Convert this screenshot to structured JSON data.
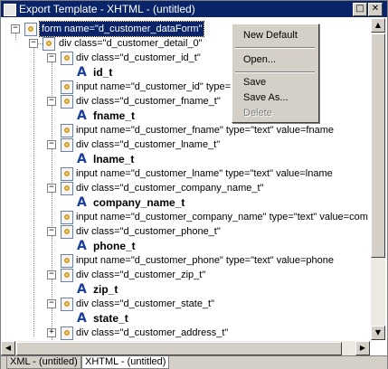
{
  "window": {
    "title": "Export Template - XHTML - (untitled)",
    "minimize_glyph": "□",
    "close_glyph": "✕"
  },
  "tree": {
    "items": [
      {
        "text": "form name=\"d_customer_dataForm\"",
        "kind": "element",
        "selected": true
      },
      {
        "text": "div class=\"d_customer_detail_0\"",
        "kind": "element"
      },
      {
        "text": "div class=\"d_customer_id_t\"",
        "kind": "element"
      },
      {
        "text": "id_t",
        "kind": "text"
      },
      {
        "text": "input name=\"d_customer_id\" type=",
        "kind": "element"
      },
      {
        "text": "div class=\"d_customer_fname_t\"",
        "kind": "element"
      },
      {
        "text": "fname_t",
        "kind": "text"
      },
      {
        "text": "input name=\"d_customer_fname\" type=\"text\" value=fname",
        "kind": "element"
      },
      {
        "text": "div class=\"d_customer_lname_t\"",
        "kind": "element"
      },
      {
        "text": "lname_t",
        "kind": "text"
      },
      {
        "text": "input name=\"d_customer_lname\" type=\"text\" value=lname",
        "kind": "element"
      },
      {
        "text": "div class=\"d_customer_company_name_t\"",
        "kind": "element"
      },
      {
        "text": "company_name_t",
        "kind": "text"
      },
      {
        "text": "input name=\"d_customer_company_name\" type=\"text\" value=com",
        "kind": "element"
      },
      {
        "text": "div class=\"d_customer_phone_t\"",
        "kind": "element"
      },
      {
        "text": "phone_t",
        "kind": "text"
      },
      {
        "text": "input name=\"d_customer_phone\" type=\"text\" value=phone",
        "kind": "element"
      },
      {
        "text": "div class=\"d_customer_zip_t\"",
        "kind": "element"
      },
      {
        "text": "zip_t",
        "kind": "text"
      },
      {
        "text": "div class=\"d_customer_state_t\"",
        "kind": "element"
      },
      {
        "text": "state_t",
        "kind": "text"
      },
      {
        "text": "div class=\"d_customer_address_t\"",
        "kind": "element"
      }
    ]
  },
  "context_menu": {
    "new_default": "New Default",
    "open": "Open...",
    "save": "Save",
    "save_as": "Save As...",
    "delete": "Delete"
  },
  "tabs": [
    {
      "label": "XML - (untitled)",
      "active": false
    },
    {
      "label": "XHTML - (untitled)",
      "active": true
    }
  ],
  "icons": {
    "expander": "expand-collapse-icon",
    "element": "xml-element-icon",
    "text": "text-node-icon"
  }
}
